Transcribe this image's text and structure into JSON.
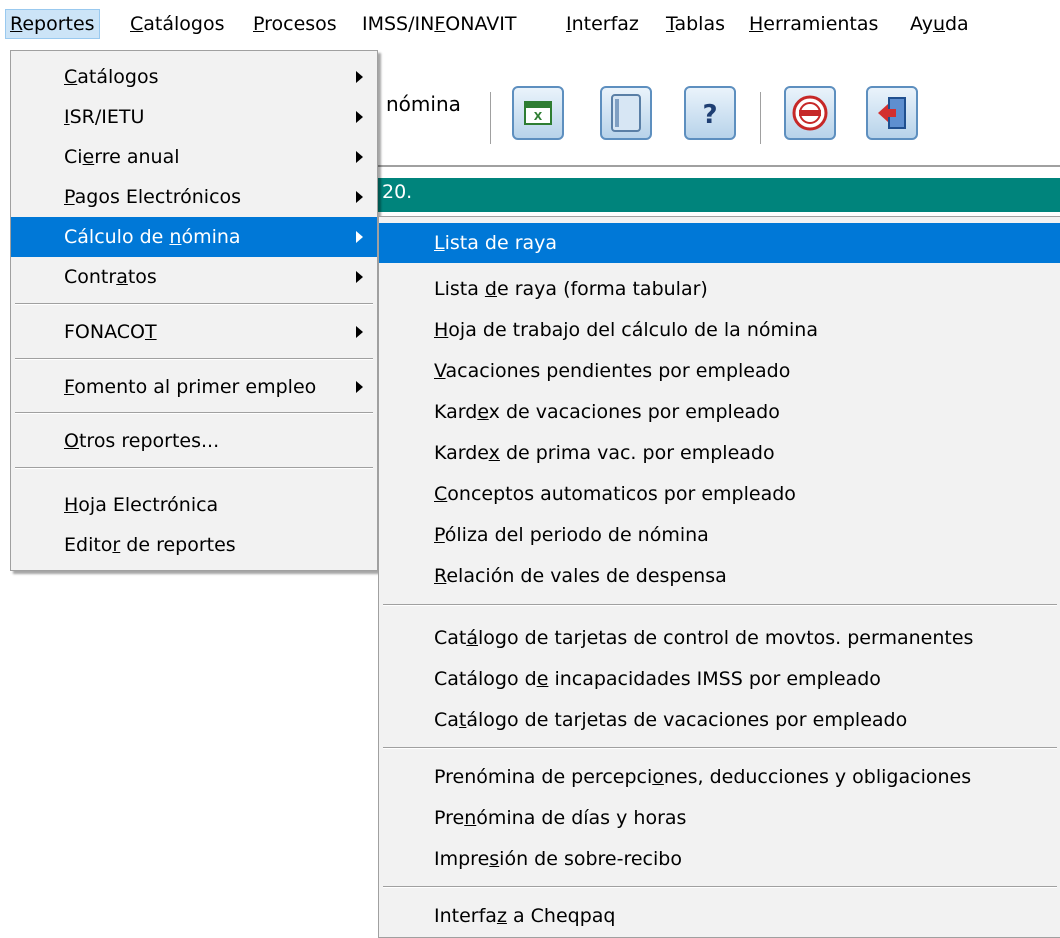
{
  "menubar": {
    "items": [
      {
        "label": "Reportes",
        "mnemonic": "R"
      },
      {
        "label": "Catálogos",
        "mnemonic": "C"
      },
      {
        "label": "Procesos",
        "mnemonic": "P"
      },
      {
        "label": "IMSS/INFONAVIT",
        "mnemonic": "F"
      },
      {
        "label": "Interfaz",
        "mnemonic": "I"
      },
      {
        "label": "Tablas",
        "mnemonic": "T"
      },
      {
        "label": "Herramientas",
        "mnemonic": "H"
      },
      {
        "label": "Ayuda",
        "mnemonic": "u"
      }
    ],
    "active": "Reportes"
  },
  "toolbar": {
    "partial_text": "nómina",
    "buttons": [
      "excel-icon",
      "window-icon",
      "help-icon",
      "imss-icon",
      "exit-icon"
    ]
  },
  "status_strip": {
    "partial_text": "20."
  },
  "reportes_menu": {
    "items": [
      {
        "label": "Catálogos",
        "mnemonic": "C",
        "submenu": true
      },
      {
        "label": "ISR/IETU",
        "mnemonic": "I",
        "submenu": true
      },
      {
        "label": "Cierre anual",
        "mnemonic": "e",
        "submenu": true
      },
      {
        "label": "Pagos Electrónicos",
        "mnemonic": "P",
        "submenu": true
      },
      {
        "label": "Cálculo de nómina",
        "mnemonic": "n",
        "submenu": true,
        "highlighted": true
      },
      {
        "label": "Contratos",
        "mnemonic": "a",
        "submenu": true
      },
      {
        "label": "FONACOT",
        "mnemonic": "T",
        "submenu": true
      },
      {
        "label": "Fomento al primer empleo",
        "mnemonic": "F",
        "submenu": true
      },
      {
        "label": "Otros reportes...",
        "mnemonic": "O",
        "submenu": false
      },
      {
        "label": "Hoja Electrónica",
        "mnemonic": "H",
        "submenu": false
      },
      {
        "label": "Editor de reportes",
        "mnemonic": "r",
        "submenu": false
      }
    ]
  },
  "calculo_submenu": {
    "items": [
      {
        "label": "Lista de raya",
        "mnemonic": "L",
        "highlighted": true
      },
      {
        "label": "Lista de raya (forma tabular)",
        "mnemonic": "d"
      },
      {
        "label": "Hoja de trabajo del cálculo de la nómina",
        "mnemonic": "H"
      },
      {
        "label": "Vacaciones pendientes por empleado",
        "mnemonic": "V"
      },
      {
        "label": "Kardex de vacaciones por empleado",
        "mnemonic": "e"
      },
      {
        "label": "Kardex de prima vac. por empleado",
        "mnemonic": "x"
      },
      {
        "label": "Conceptos automaticos por empleado",
        "mnemonic": "C"
      },
      {
        "label": "Póliza del periodo de nómina",
        "mnemonic": "P"
      },
      {
        "label": "Relación de vales de despensa",
        "mnemonic": "R"
      },
      {
        "label": "Catálogo de tarjetas de control de movtos. permanentes",
        "mnemonic": "á"
      },
      {
        "label": "Catálogo de incapacidades IMSS por empleado",
        "mnemonic": "e"
      },
      {
        "label": "Catálogo de tarjetas de vacaciones por empleado",
        "mnemonic": "t"
      },
      {
        "label": "Prenómina de percepciones, deducciones y obligaciones",
        "mnemonic": "o"
      },
      {
        "label": "Prenómina de días y horas",
        "mnemonic": "n"
      },
      {
        "label": "Impresión de sobre-recibo",
        "mnemonic": "s"
      },
      {
        "label": "Interfaz a Cheqpaq",
        "mnemonic": "z"
      }
    ]
  },
  "colors": {
    "highlight": "#0078d7",
    "menu_bg": "#f2f2f2",
    "status_strip": "#00847c",
    "menubar_active": "#cce4f7"
  }
}
